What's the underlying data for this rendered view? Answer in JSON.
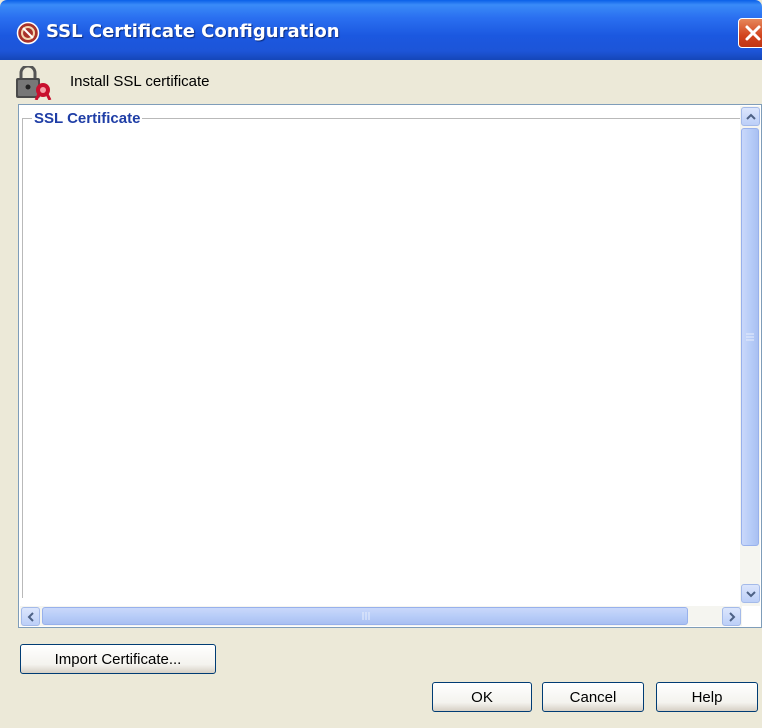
{
  "window": {
    "title": "SSL Certificate Configuration"
  },
  "header": {
    "label": "Install SSL certificate",
    "icon": "lock-certificate-icon"
  },
  "group": {
    "title": "SSL Certificate"
  },
  "buttons": {
    "import": "Import Certificate...",
    "ok": "OK",
    "cancel": "Cancel",
    "help": "Help"
  },
  "colors": {
    "titlebar": "#1D55D8",
    "close": "#D2441E",
    "group_title": "#1F3EA6",
    "dialog_bg": "#ECE9D8"
  }
}
